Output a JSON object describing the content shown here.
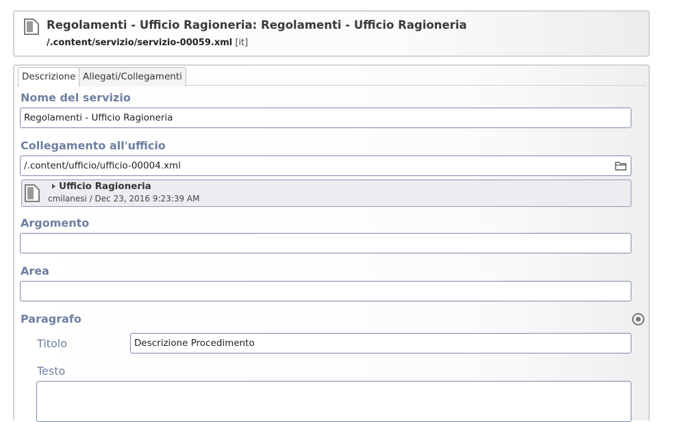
{
  "header": {
    "title": "Regolamenti - Ufficio Ragioneria: Regolamenti - Ufficio Ragioneria",
    "path": "/.content/servizio/servizio-00059.xml",
    "lang": "[it]"
  },
  "tabs": [
    {
      "label": "Descrizione",
      "active": true
    },
    {
      "label": "Allegati/Collegamenti",
      "active": false
    }
  ],
  "fields": {
    "nome": {
      "label": "Nome del servizio",
      "value": "Regolamenti - Ufficio Ragioneria"
    },
    "collegamento": {
      "label": "Collegamento all'ufficio",
      "value": "/.content/ufficio/ufficio-00004.xml",
      "preview_title": "Ufficio Ragioneria",
      "preview_meta": "cmilanesi / Dec 23, 2016 9:23:39 AM"
    },
    "argomento": {
      "label": "Argomento",
      "value": ""
    },
    "area": {
      "label": "Area",
      "value": ""
    },
    "paragrafo": {
      "label": "Paragrafo",
      "titolo_label": "Titolo",
      "titolo_value": "Descrizione Procedimento",
      "testo_label": "Testo",
      "testo_value": ""
    }
  },
  "icons": {
    "header": "document-icon",
    "folder": "folder-icon",
    "preview": "document-icon",
    "paragraph_options": "target-icon"
  }
}
